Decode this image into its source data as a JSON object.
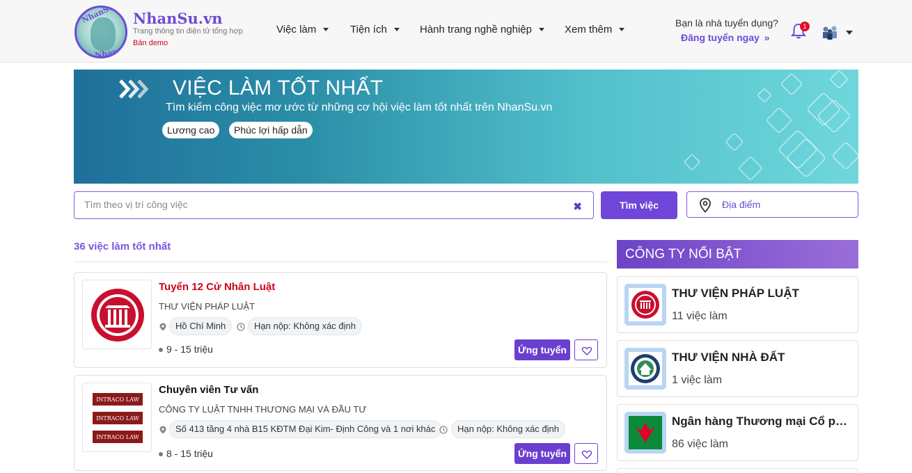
{
  "header": {
    "brand": "NhanSu.vn",
    "tagline": "Trang thông tin điện tử tổng hợp",
    "demo_label": "Bản demo",
    "logo_text_top": "NhanSu",
    "logo_text_bottom": "NhanSu",
    "nav": [
      {
        "label": "Việc làm"
      },
      {
        "label": "Tiện ích"
      },
      {
        "label": "Hành trang nghề nghiệp"
      },
      {
        "label": "Xem thêm"
      }
    ],
    "recruiter_question": "Bạn là nhà tuyển dụng?",
    "recruiter_link": "Đăng tuyển ngay",
    "recruiter_link_icon": "double-chevron-right-icon",
    "notification_count": "1"
  },
  "banner": {
    "title": "VIỆC LÀM TỐT NHẤT",
    "subtitle": "Tìm kiếm công việc mơ ước từ những cơ hội việc làm tốt nhất trên NhanSu.vn",
    "tags": [
      "Lương cao",
      "Phúc lợi hấp dẫn"
    ]
  },
  "search": {
    "placeholder": "Tìm theo vị trí công việc",
    "value": "",
    "button_label": "Tìm việc",
    "location_label": "Địa điểm"
  },
  "jobs": {
    "count_label": "36 việc làm tốt nhất",
    "items": [
      {
        "title": "Tuyển 12 Cử Nhân Luật",
        "title_color": "#d0021b",
        "company": "THƯ VIỆN PHÁP LUẬT",
        "location": "Hồ Chí Minh",
        "deadline": "Hạn nộp: Không xác định",
        "salary": "9 - 15 triệu",
        "apply_label": "Ứng tuyển"
      },
      {
        "title": "Chuyên viên Tư vấn",
        "title_color": "#111111",
        "company": "CÔNG TY LUẬT TNHH THƯƠNG MẠI VÀ ĐẦU TƯ",
        "location": "Số 413 tầng 4 nhà B15 KĐTM Đại Kim- Định Công và 1 nơi khác",
        "deadline": "Hạn nộp: Không xác định",
        "salary": "8 - 15 triệu",
        "apply_label": "Ứng tuyển",
        "logo_text": "INTRACO LAW"
      }
    ]
  },
  "sidebar": {
    "title": "CÔNG TY NỔI BẬT",
    "companies": [
      {
        "name": "THƯ VIỆN PHÁP LUẬT",
        "jobs": "11 việc làm"
      },
      {
        "name": "THƯ VIỆN NHÀ ĐẤT",
        "jobs": "1 việc làm"
      },
      {
        "name": "Ngân hàng Thương mại Cổ phần Việt Nam Thịnh Vượng",
        "jobs": "86 việc làm"
      }
    ]
  },
  "colors": {
    "accent": "#6c4bd6",
    "button": "#6a3fd0",
    "banner_start": "#1f6f9a",
    "banner_end": "#6fd7dc",
    "job_title_red": "#d0021b"
  }
}
